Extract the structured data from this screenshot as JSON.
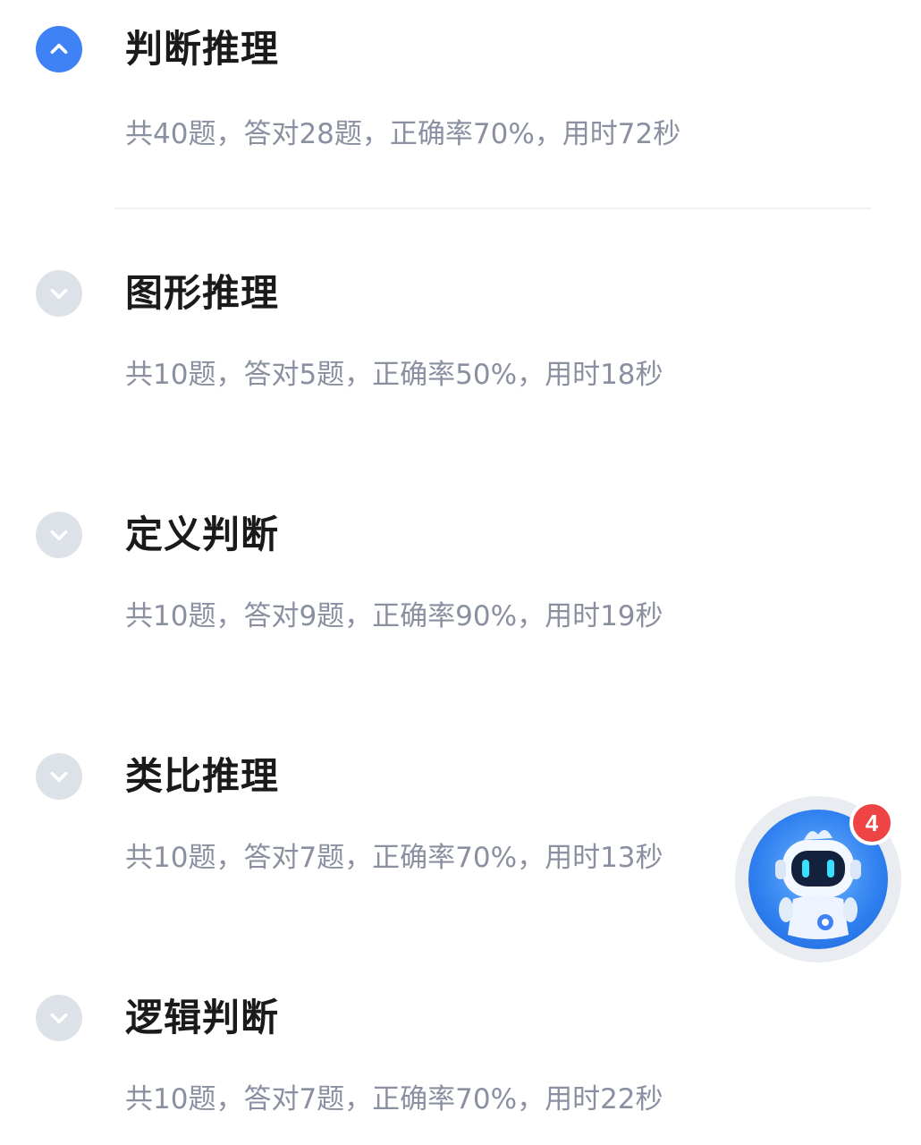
{
  "sections": [
    {
      "title": "判断推理",
      "stats": "共40题，答对28题，正确率70%，用时72秒",
      "expanded": true,
      "toggle_icon": "chevron-up-icon"
    },
    {
      "title": "图形推理",
      "stats": "共10题，答对5题，正确率50%，用时18秒",
      "expanded": false,
      "toggle_icon": "chevron-down-icon"
    },
    {
      "title": "定义判断",
      "stats": "共10题，答对9题，正确率90%，用时19秒",
      "expanded": false,
      "toggle_icon": "chevron-down-icon"
    },
    {
      "title": "类比推理",
      "stats": "共10题，答对7题，正确率70%，用时13秒",
      "expanded": false,
      "toggle_icon": "chevron-down-icon"
    },
    {
      "title": "逻辑判断",
      "stats": "共10题，答对7题，正确率70%，用时22秒",
      "expanded": false,
      "toggle_icon": "chevron-down-icon"
    }
  ],
  "assistant": {
    "icon": "robot-assistant-icon",
    "badge_count": "4"
  },
  "colors": {
    "accent": "#3f82f6",
    "collapsed_toggle": "#dde2e8",
    "title": "#1a1a1a",
    "stats": "#8a90a0",
    "badge": "#ef4444"
  }
}
